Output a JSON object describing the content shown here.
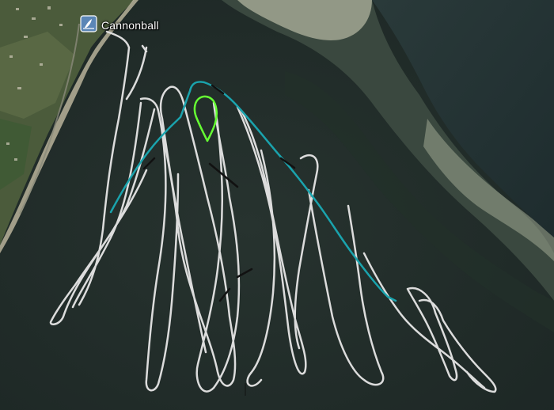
{
  "place": {
    "label": "Cannonball",
    "icon": "windsurf-marker-icon"
  },
  "colors": {
    "track_main": "#dcdcdc",
    "track_fast": "#1aa3ad",
    "track_highlight": "#66ff33",
    "track_dark": "#111111",
    "water": "#243230",
    "land": "#4a5a3a"
  }
}
